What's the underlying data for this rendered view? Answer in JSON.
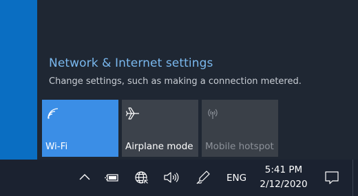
{
  "flyout": {
    "settings_link": "Network & Internet settings",
    "settings_description": "Change settings, such as making a connection metered.",
    "tiles": [
      {
        "id": "wifi",
        "label": "Wi-Fi",
        "state": "on",
        "icon": "wifi-icon"
      },
      {
        "id": "airplane",
        "label": "Airplane mode",
        "state": "off",
        "icon": "airplane-icon"
      },
      {
        "id": "hotspot",
        "label": "Mobile hotspot",
        "state": "disabled",
        "icon": "hotspot-icon"
      }
    ]
  },
  "taskbar": {
    "language": "ENG",
    "time": "5:41 PM",
    "date": "2/12/2020",
    "tray_icons": [
      "chevron-up-icon",
      "battery-icon",
      "network-icon",
      "volume-icon",
      "pen-icon"
    ]
  },
  "colors": {
    "accent": "#3b8ee6",
    "link": "#7ab8ee",
    "flyout_background": "#1f2733",
    "taskbar_background": "#1b2230",
    "desktop": "#0a6ec2"
  }
}
